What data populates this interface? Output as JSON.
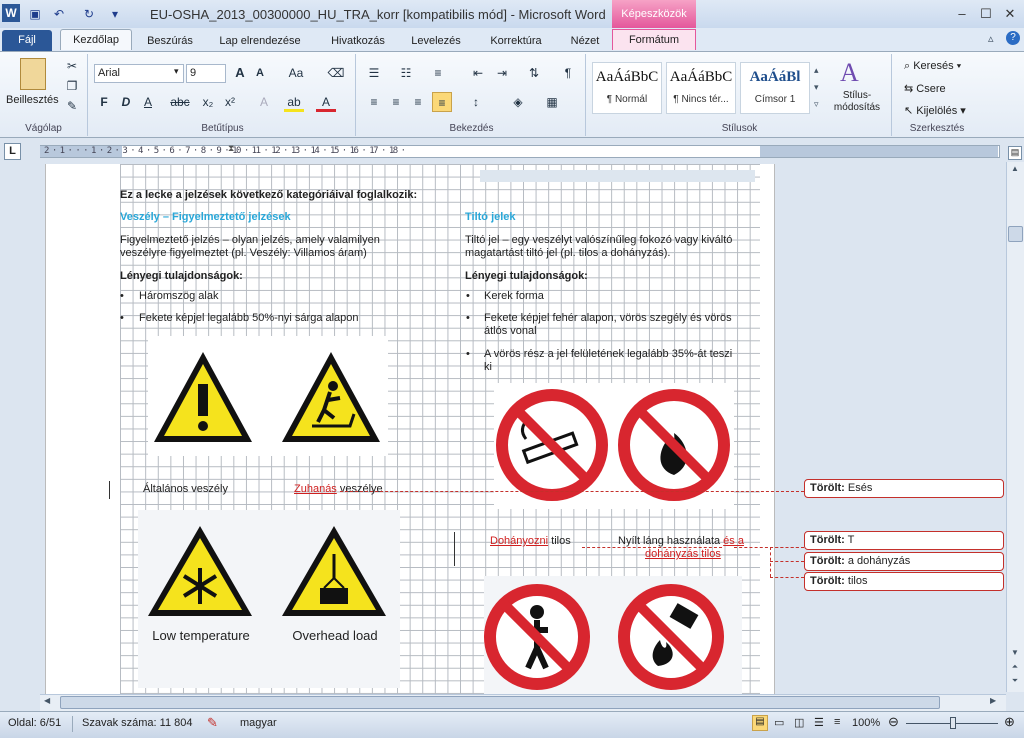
{
  "window": {
    "title": "EU-OSHA_2013_00300000_HU_TRA_korr [kompatibilis mód]  -  Microsoft Word",
    "context_tab_group": "Képeszközök",
    "controls": {
      "minimize": "–",
      "maximize": "☐",
      "close": "✕"
    }
  },
  "tabs": {
    "file": "Fájl",
    "home": "Kezdőlap",
    "insert": "Beszúrás",
    "layout": "Lap elrendezése",
    "references": "Hivatkozás",
    "mailings": "Levelezés",
    "review": "Korrektúra",
    "view": "Nézet",
    "format": "Formátum"
  },
  "ribbon": {
    "clipboard": {
      "label": "Vágólap",
      "paste": "Beillesztés"
    },
    "font": {
      "label": "Betűtípus",
      "family": "Arial",
      "size": "9"
    },
    "paragraph": {
      "label": "Bekezdés"
    },
    "styles": {
      "label": "Stílusok",
      "sample": "AaÁáBbC",
      "sample_heading": "AaÁáBl",
      "normal": "¶ Normál",
      "no_spacing": "¶ Nincs tér...",
      "heading1": "Címsor 1",
      "change": "Stílus-módosítás"
    },
    "editing": {
      "label": "Szerkesztés",
      "find": "Keresés",
      "replace": "Csere",
      "select": "Kijelölés"
    }
  },
  "ruler": {
    "marks": "2 · 1 · · · 1 · 2 · 3 · 4 · 5 · 6 · 7 · 8 · 9 · 10 · 11 · 12 · 13 · 14 · 15 · 16 · 17 · 18 ·",
    "tab_selector": "L"
  },
  "doc": {
    "intro": "Ez a lecke a jelzések következő kategóriáival foglalkozik:",
    "left": {
      "heading": "Veszély – Figyelmeztető jelzések",
      "desc1": "Figyelmeztető jelzés – olyan jelzés, amely valamilyen",
      "desc2": "veszélyre figyelmeztet (pl. Veszély: Villamos áram)",
      "key": "Lényegi tulajdonságok:",
      "bullets": [
        "Háromszög alak",
        "Fekete képjel legalább 50%-nyi sárga alapon"
      ],
      "caption_general": "Általános veszély",
      "caption_fall_ins": "Zuhanás",
      "caption_fall_rest": " veszélye",
      "img_low_temp": "Low temperature",
      "img_overhead": "Overhead load"
    },
    "right": {
      "heading": "Tiltó jelek",
      "desc1": "Tiltó jel – egy veszélyt valószínűleg fokozó vagy kiváltó",
      "desc2": "magatartást tiltó jel (pl. tilos a dohányzás).",
      "key": "Lényegi tulajdonságok:",
      "bullets": [
        "Kerek forma",
        "Fekete képjel fehér alapon, vörös szegély és vörös",
        "átlós vonal",
        "A vörös rész a jel felületének legalább 35%-át teszi",
        "ki"
      ],
      "caption_smoke_ins": "Dohányozni",
      "caption_smoke_rest": " tilos",
      "caption_flame_a": "Nyílt láng használata ",
      "caption_flame_ins1": "és a",
      "caption_flame_ins2": "dohányzás tilos"
    }
  },
  "comments": [
    {
      "label": "Törölt:",
      "text": " Esés"
    },
    {
      "label": "Törölt:",
      "text": " T"
    },
    {
      "label": "Törölt:",
      "text": "  a dohányzás"
    },
    {
      "label": "Törölt:",
      "text": " tilos"
    }
  ],
  "status": {
    "page": "Oldal: 6/51",
    "words": "Szavak száma: 11 804",
    "language": "magyar",
    "zoom": "100%"
  },
  "colors": {
    "accent": "#2b5797",
    "context": "#e4579b",
    "revision": "#c4302b",
    "heading_cyan": "#29a7d8",
    "warning_yellow": "#f5e31d",
    "prohibit_red": "#d8262f"
  }
}
